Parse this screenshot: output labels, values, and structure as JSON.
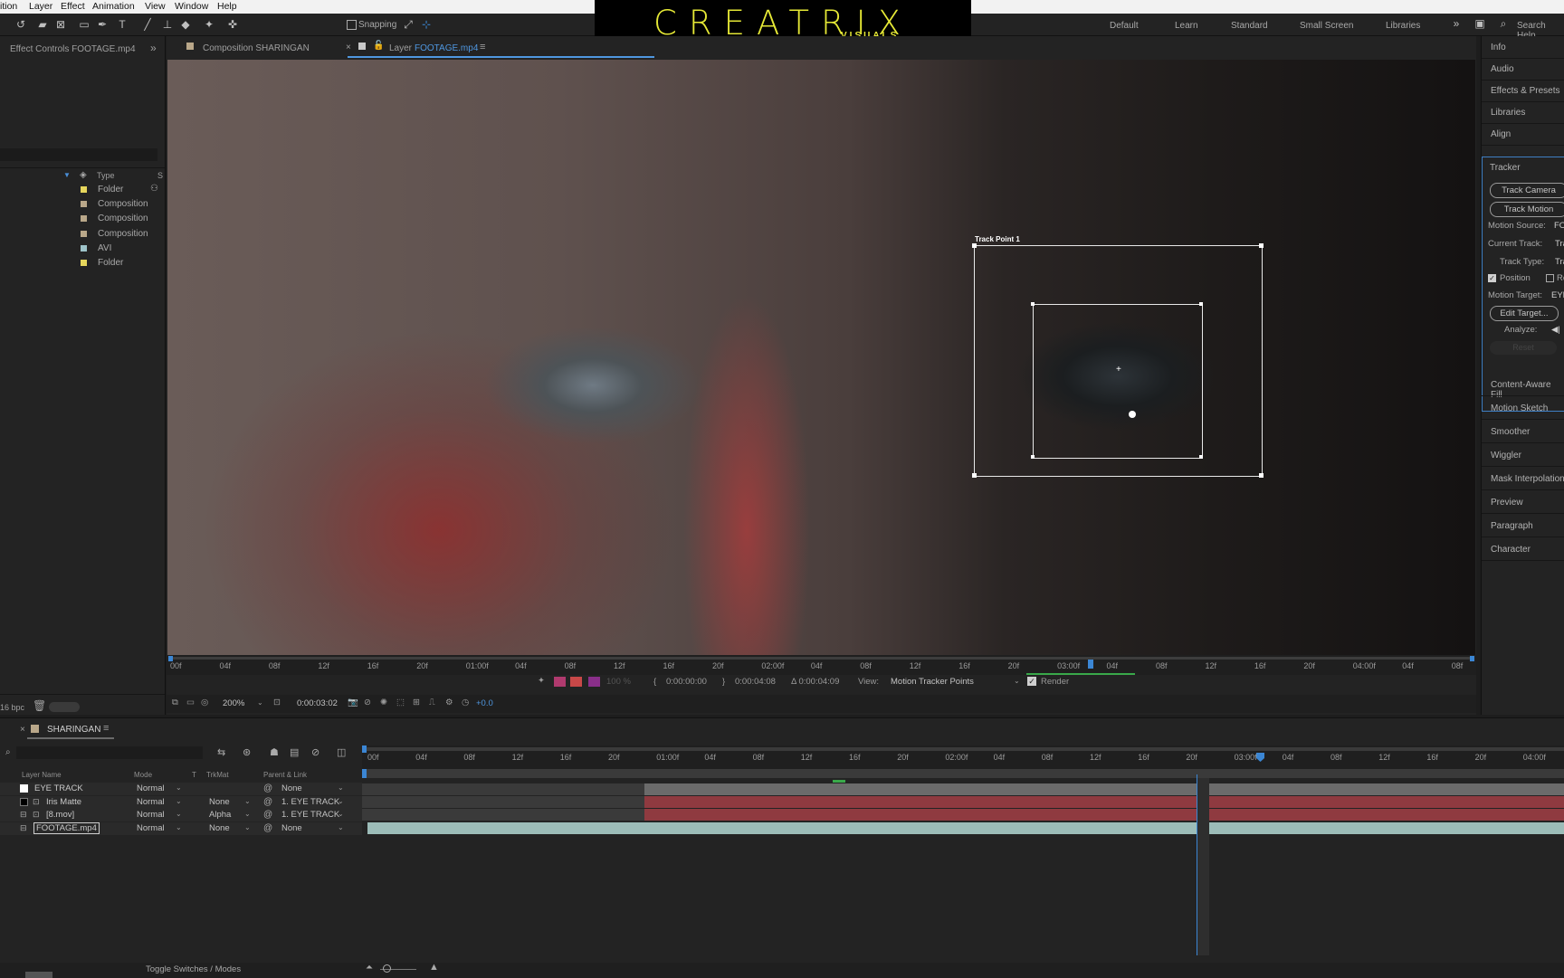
{
  "menu": [
    "ition",
    "Layer",
    "Effect",
    "Animation",
    "View",
    "Window",
    "Help"
  ],
  "toolbar": {
    "snapping_label": "Snapping",
    "workspaces": [
      "Default",
      "Learn",
      "Standard",
      "Small Screen",
      "Libraries"
    ],
    "search_label": "Search Help"
  },
  "logo": {
    "title": "CREATRIX",
    "subtitle": "VISUALS"
  },
  "left_panel": {
    "tab_label": "Effect Controls FOOTAGE.mp4",
    "type_header": "Type",
    "items": [
      {
        "type": "Folder",
        "color": "#e6d65c"
      },
      {
        "type": "Composition",
        "color": "#b9a789"
      },
      {
        "type": "Composition",
        "color": "#b9a789"
      },
      {
        "type": "Composition",
        "color": "#b9a789"
      },
      {
        "type": "AVI",
        "color": "#9ec3c9"
      },
      {
        "type": "Folder",
        "color": "#e6d65c"
      }
    ],
    "bpc_label": "16 bpc"
  },
  "viewer": {
    "tab_composition": "Composition  SHARINGAN",
    "tab_layer_prefix": "Layer",
    "tab_layer_name": "FOOTAGE.mp4",
    "track_point_label": "Track Point 1",
    "ruler_ticks": [
      "00f",
      "04f",
      "08f",
      "12f",
      "16f",
      "20f",
      "01:00f",
      "04f",
      "08f",
      "12f",
      "16f",
      "20f",
      "02:00f",
      "04f",
      "08f",
      "12f",
      "16f",
      "20f",
      "03:00f",
      "04f",
      "08f",
      "12f",
      "16f",
      "20f",
      "04:00f",
      "04f",
      "08f"
    ],
    "time_in": "0:00:00:00",
    "time_out": "0:00:04:08",
    "time_duration": "Δ 0:00:04:09",
    "view_label": "View:",
    "view_value": "Motion Tracker Points",
    "render_label": "Render",
    "zoom": "200%",
    "current_time": "0:00:03:02",
    "exposure": "+0.0"
  },
  "right_panel": {
    "panels_top": [
      "Info",
      "Audio",
      "Effects & Presets",
      "Libraries",
      "Align",
      "Tracker"
    ],
    "track_camera": "Track Camera",
    "track_motion": "Track Motion",
    "motion_source_label": "Motion Source:",
    "motion_source_value": "FO",
    "current_track_label": "Current Track:",
    "current_track_value": "Tra",
    "track_type_label": "Track Type:",
    "track_type_value": "Tra",
    "position_label": "Position",
    "rotation_label": "Ro",
    "motion_target_label": "Motion Target:",
    "motion_target_value": "EYE",
    "edit_target": "Edit Target...",
    "analyze_label": "Analyze:",
    "reset_label": "Reset",
    "panels_bottom": [
      "Content-Aware Fill",
      "Motion Sketch",
      "Smoother",
      "Wiggler",
      "Mask Interpolation",
      "Preview",
      "Paragraph",
      "Character"
    ]
  },
  "timeline": {
    "comp_tab": "SHARINGAN",
    "col_layer_name": "Layer Name",
    "col_mode": "Mode",
    "col_t": "T",
    "col_trkmat": "TrkMat",
    "col_parent": "Parent & Link",
    "ticks": [
      "00f",
      "04f",
      "08f",
      "12f",
      "16f",
      "20f",
      "01:00f",
      "04f",
      "08f",
      "12f",
      "16f",
      "20f",
      "02:00f",
      "04f",
      "08f",
      "12f",
      "16f",
      "20f",
      "03:00f",
      "04f",
      "08f",
      "12f",
      "16f",
      "20f",
      "04:00f"
    ],
    "layers": [
      {
        "name": "EYE TRACK",
        "mode": "Normal",
        "trkmat": "",
        "parent": "None",
        "swatch": "#ffffff"
      },
      {
        "name": "Iris Matte",
        "mode": "Normal",
        "trkmat": "None",
        "parent": "1. EYE TRACK",
        "swatch": "#000000"
      },
      {
        "name": "[8.mov]",
        "mode": "Normal",
        "trkmat": "Alpha",
        "parent": "1. EYE TRACK",
        "swatch": ""
      },
      {
        "name": "FOOTAGE.mp4",
        "mode": "Normal",
        "trkmat": "None",
        "parent": "None",
        "swatch": ""
      }
    ],
    "toggle_label": "Toggle Switches / Modes"
  }
}
